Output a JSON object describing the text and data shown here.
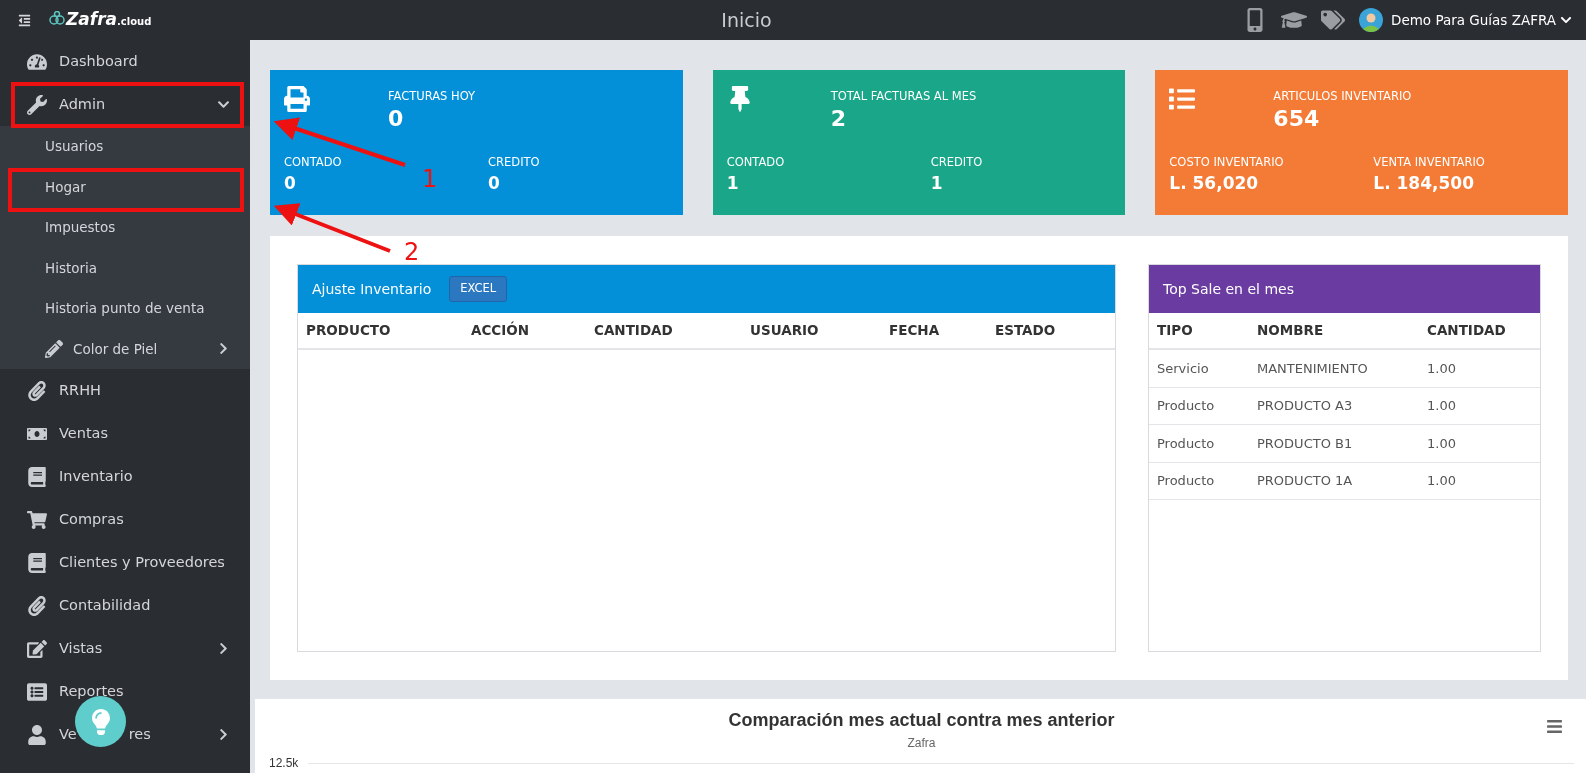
{
  "logo": {
    "name": "Zafra",
    "suffix": ".cloud"
  },
  "topbar": {
    "title": "Inicio",
    "user": "Demo Para Guías ZAFRA"
  },
  "sidebar": {
    "items": [
      {
        "label": "Dashboard",
        "kind": "link"
      },
      {
        "label": "Admin",
        "kind": "group",
        "expanded": true,
        "children": [
          {
            "label": "Usuarios",
            "kind": "link"
          },
          {
            "label": "Hogar",
            "kind": "link"
          },
          {
            "label": "Impuestos",
            "kind": "link"
          },
          {
            "label": "Historia",
            "kind": "link"
          },
          {
            "label": "Historia punto de venta",
            "kind": "link"
          },
          {
            "label": "Color de Piel",
            "kind": "group",
            "expanded": false
          }
        ]
      },
      {
        "label": "RRHH",
        "kind": "link"
      },
      {
        "label": "Ventas",
        "kind": "link"
      },
      {
        "label": "Inventario",
        "kind": "link"
      },
      {
        "label": "Compras",
        "kind": "link"
      },
      {
        "label": "Clientes y Proveedores",
        "kind": "link"
      },
      {
        "label": "Contabilidad",
        "kind": "link"
      },
      {
        "label": "Vistas",
        "kind": "group",
        "expanded": false
      },
      {
        "label": "Reportes",
        "kind": "link"
      },
      {
        "label": "Ve",
        "label_tail": "res",
        "kind": "group",
        "expanded": false
      }
    ]
  },
  "stat_cards": [
    {
      "title": "FACTURAS HOY",
      "value": "0",
      "color": "#0390d8",
      "stats": [
        {
          "label": "CONTADO",
          "value": "0"
        },
        {
          "label": "CREDITO",
          "value": "0"
        }
      ]
    },
    {
      "title": "TOTAL FACTURAS AL MES",
      "value": "2",
      "color": "#1aa688",
      "stats": [
        {
          "label": "CONTADO",
          "value": "1"
        },
        {
          "label": "CREDITO",
          "value": "1"
        }
      ]
    },
    {
      "title": "ARTICULOS INVENTARIO",
      "value": "654",
      "color": "#f47b35",
      "stats": [
        {
          "label": "COSTO INVENTARIO",
          "value": "L. 56,020"
        },
        {
          "label": "VENTA INVENTARIO",
          "value": "L. 184,500"
        }
      ]
    }
  ],
  "inventory_table": {
    "title": "Ajuste Inventario",
    "button": "EXCEL",
    "columns": [
      "PRODUCTO",
      "ACCIÓN",
      "CANTIDAD",
      "USUARIO",
      "FECHA",
      "ESTADO"
    ]
  },
  "top_sale_table": {
    "title": "Top Sale en el mes",
    "columns": [
      "TIPO",
      "NOMBRE",
      "CANTIDAD"
    ],
    "rows": [
      [
        "Servicio",
        "MANTENIMIENTO",
        "1.00"
      ],
      [
        "Producto",
        "PRODUCTO A3",
        "1.00"
      ],
      [
        "Producto",
        "PRODUCTO B1",
        "1.00"
      ],
      [
        "Producto",
        "PRODUCTO 1A",
        "1.00"
      ]
    ]
  },
  "chart": {
    "title": "Comparación mes actual contra mes anterior",
    "subtitle": "Zafra",
    "y_tick": "12.5k"
  },
  "annotations": [
    {
      "label": "1"
    },
    {
      "label": "2"
    }
  ]
}
